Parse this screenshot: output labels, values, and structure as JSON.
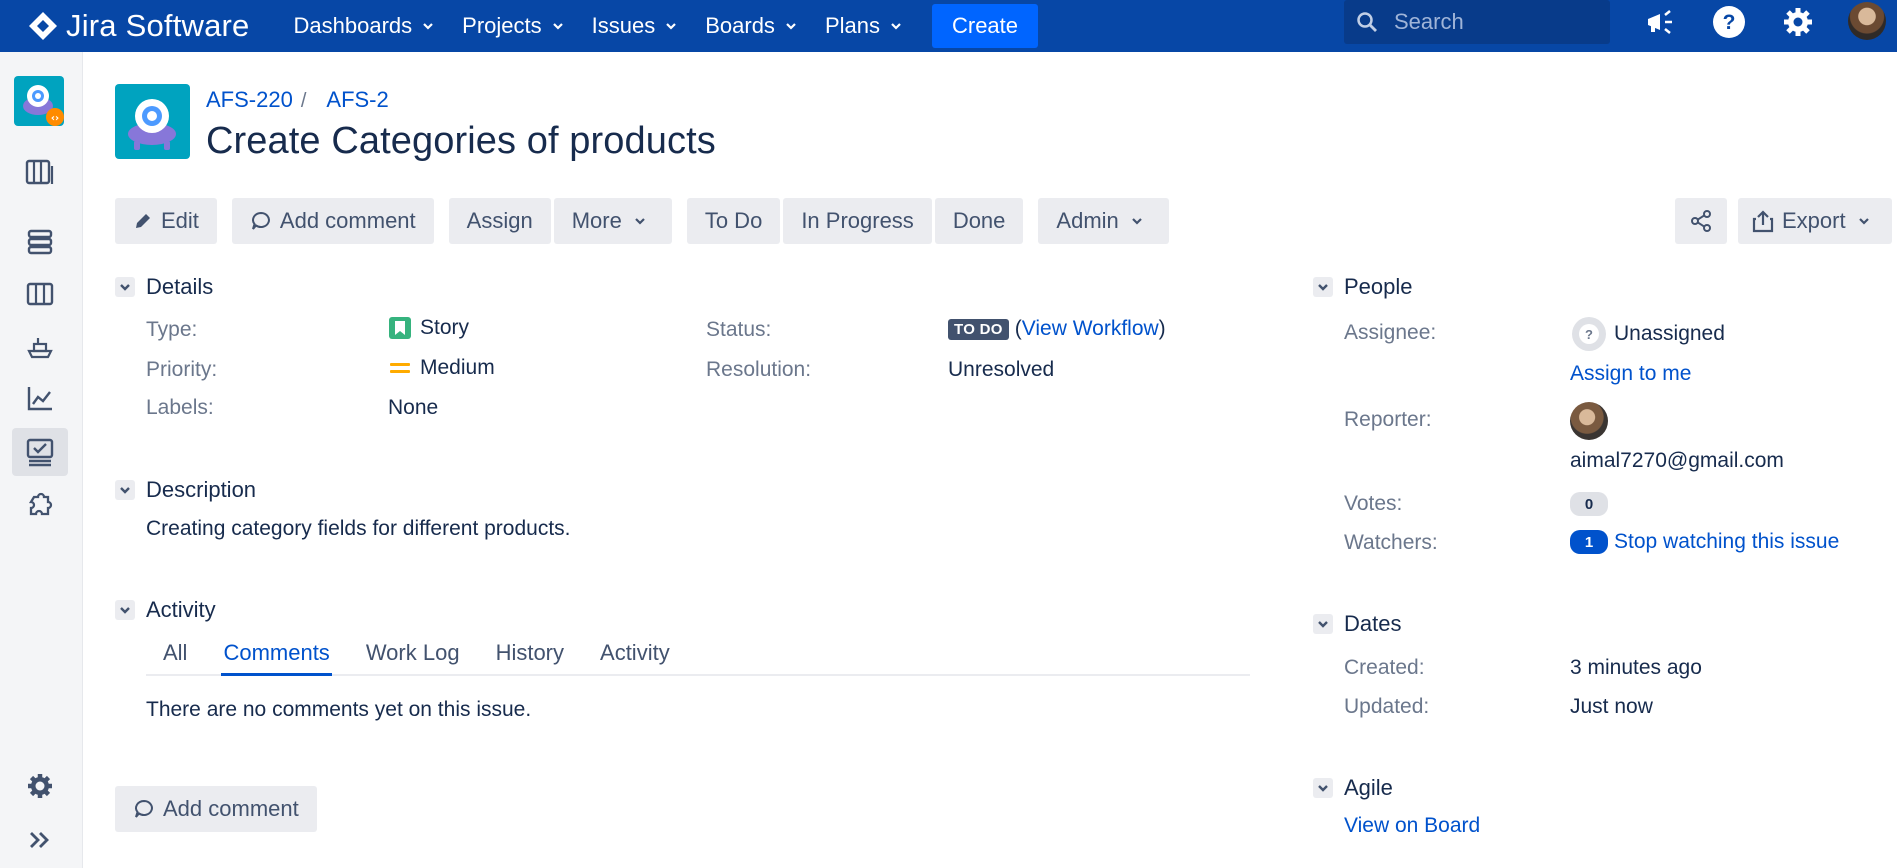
{
  "topnav": {
    "brand": "Jira Software",
    "items": [
      {
        "label": "Dashboards"
      },
      {
        "label": "Projects"
      },
      {
        "label": "Issues"
      },
      {
        "label": "Boards"
      },
      {
        "label": "Plans"
      }
    ],
    "create_label": "Create",
    "search_placeholder": "Search",
    "icons": [
      "announcement-icon",
      "help-icon",
      "settings-icon"
    ],
    "colors": {
      "bar": "#0747a6",
      "create": "#0065ff"
    }
  },
  "sidebar": {
    "icons": [
      "project-avatar",
      "backlog-icon",
      "board-icon",
      "columns-icon",
      "releases-icon",
      "reports-icon",
      "issues-icon",
      "components-icon",
      "settings-icon",
      "expand-icon"
    ]
  },
  "header": {
    "breadcrumb": [
      {
        "label": "AFS-220"
      },
      {
        "label": "AFS-2"
      }
    ],
    "breadcrumb_separator": "/",
    "title": "Create Categories of products"
  },
  "toolbar": {
    "edit": "Edit",
    "add_comment": "Add comment",
    "assign": "Assign",
    "more": "More",
    "todo": "To Do",
    "in_progress": "In Progress",
    "done": "Done",
    "admin": "Admin",
    "export": "Export"
  },
  "details": {
    "heading": "Details",
    "type_label": "Type:",
    "type_value": "Story",
    "priority_label": "Priority:",
    "priority_value": "Medium",
    "labels_label": "Labels:",
    "labels_value": "None",
    "status_label": "Status:",
    "status_value": "TO DO",
    "status_open_paren": "(",
    "status_workflow": "View Workflow",
    "status_close_paren": ")",
    "resolution_label": "Resolution:",
    "resolution_value": "Unresolved"
  },
  "description": {
    "heading": "Description",
    "text": "Creating category fields for different products."
  },
  "activity": {
    "heading": "Activity",
    "tabs": [
      {
        "label": "All"
      },
      {
        "label": "Comments"
      },
      {
        "label": "Work Log"
      },
      {
        "label": "History"
      },
      {
        "label": "Activity"
      }
    ],
    "active_tab": "Comments",
    "empty_text": "There are no comments yet on this issue.",
    "add_comment": "Add comment"
  },
  "people": {
    "heading": "People",
    "assignee_label": "Assignee:",
    "assignee_value": "Unassigned",
    "assign_to_me": "Assign to me",
    "reporter_label": "Reporter:",
    "reporter_value": "aimal7270@gmail.com",
    "votes_label": "Votes:",
    "votes_value": "0",
    "watchers_label": "Watchers:",
    "watchers_count": "1",
    "watchers_link": "Stop watching this issue"
  },
  "dates": {
    "heading": "Dates",
    "created_label": "Created:",
    "created_value": "3 minutes ago",
    "updated_label": "Updated:",
    "updated_value": "Just now"
  },
  "agile": {
    "heading": "Agile",
    "link": "View on Board"
  }
}
